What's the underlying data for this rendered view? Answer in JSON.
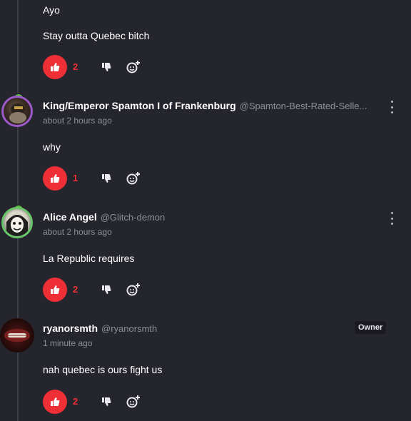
{
  "comments": [
    {
      "body": "Ayo",
      "body2": "Stay outta Quebec bitch",
      "likes": "2"
    },
    {
      "name": "King/Emperor Spamton I of Frankenburg",
      "handle": "@Spamton-Best-Rated-Selle...",
      "time": "about 2 hours ago",
      "body": "why",
      "likes": "1"
    },
    {
      "name": "Alice Angel",
      "handle": "@Glitch-demon",
      "time": "about 2 hours ago",
      "body": "La Republic requires",
      "likes": "2"
    },
    {
      "name": "ryanorsmth",
      "handle": "@ryanorsmth",
      "time": "1 minute ago",
      "badge": "Owner",
      "body": "nah quebec is ours fight us",
      "likes": "2"
    }
  ],
  "colors": {
    "background": "#25252d",
    "accent": "#ee2f36",
    "muted_text": "#8e8e98"
  },
  "icons": [
    "thumbs-up-icon",
    "thumbs-down-icon",
    "add-reaction-icon",
    "more-options-icon"
  ]
}
